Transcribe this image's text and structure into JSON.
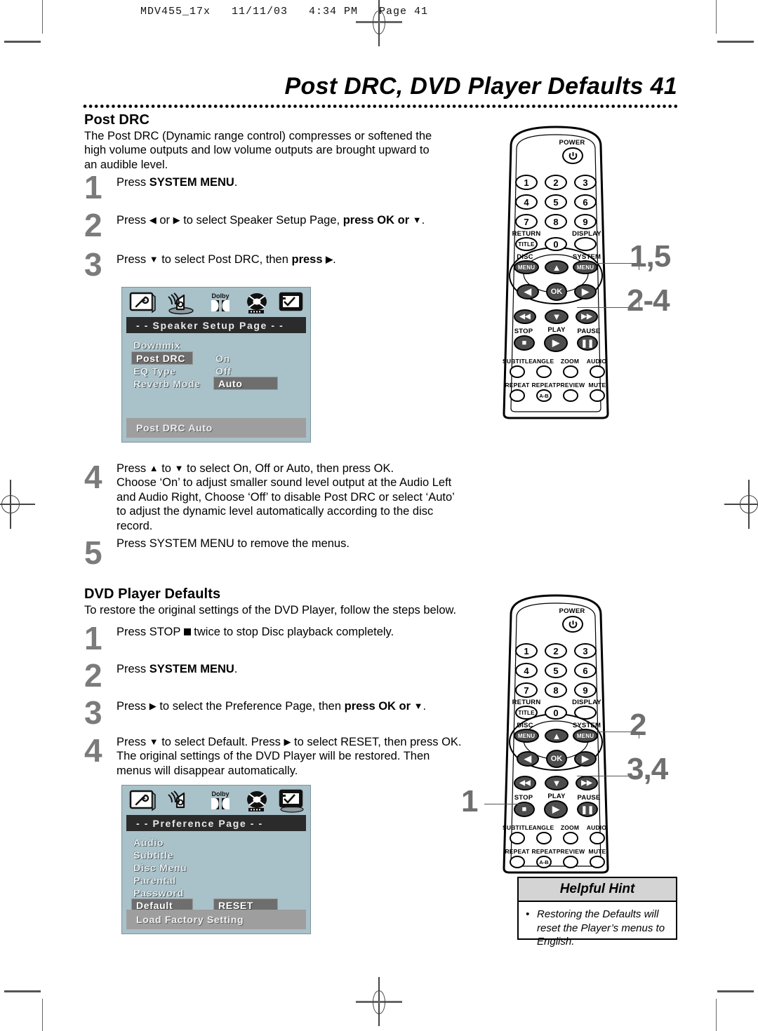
{
  "printer_header": "MDV455_17x   11/11/03   4:34 PM   Page 41",
  "page_title": "Post DRC, DVD Player Defaults  41",
  "page_number": "41",
  "sections": [
    {
      "heading": "Post DRC",
      "intro": "The Post DRC (Dynamic range control) compresses or softened the high volume outputs and low volume outputs are brought upward to an audible level.",
      "steps": [
        {
          "num": "1",
          "text_html": "Press <b>SYSTEM MENU</b>."
        },
        {
          "num": "2",
          "text_html": "Press <span class=\"kbd\">◀</span> or <span class=\"kbd\">▶</span> to select Speaker Setup Page, <b>press OK or <span class=\"kbd\">▼</span></b>."
        },
        {
          "num": "3",
          "text_html": "Press <span class=\"kbd\">▼</span> to select Post DRC, then <b>press <span class=\"kbd\">▶</span></b>."
        },
        {
          "num": "4",
          "text_html": "Press <span class=\"kbd\">▲</span> to <span class=\"kbd\">▼</span> to select On, Off or Auto, then press OK.<br>Choose ‘On’ to adjust smaller sound level output at the Audio Left and Audio Right, Choose ‘Off’ to disable Post DRC or select ‘Auto’ to adjust the dynamic level automatically according to the disc record."
        },
        {
          "num": "5",
          "text_html": "Press SYSTEM MENU to remove the menus."
        }
      ]
    },
    {
      "heading": "DVD Player Defaults",
      "intro": "To restore the original settings of the DVD Player, follow the steps below.",
      "steps": [
        {
          "num": "1",
          "text_html": "Press STOP <span class=\"sq\"></span> twice to stop Disc playback completely."
        },
        {
          "num": "2",
          "text_html": "Press <b>SYSTEM MENU</b>."
        },
        {
          "num": "3",
          "text_html": "Press <span class=\"kbd\">▶</span> to select the Preference Page, then <b>press OK or <span class=\"kbd\">▼</span></b>."
        },
        {
          "num": "4",
          "text_html": "Press <span class=\"kbd\">▼</span> to select Default. Press <span class=\"kbd\">▶</span> to select RESET, then press OK.<br>The original settings of the DVD Player will be restored. Then menus will disappear automatically."
        }
      ]
    }
  ],
  "osd_speaker": {
    "icons": [
      "general-setup-icon",
      "speaker-setup-icon",
      "dolby-audio-icon",
      "video-setup-icon",
      "preference-icon"
    ],
    "title": "- -  Speaker Setup Page  - -",
    "rows": [
      {
        "label": "Downmix",
        "value": "",
        "label_highlighted": false,
        "value_highlighted": false
      },
      {
        "label": "Post DRC",
        "value": "On",
        "label_highlighted": true,
        "value_highlighted": false
      },
      {
        "label": "EQ Type",
        "value": "Off",
        "label_highlighted": false,
        "value_highlighted": false
      },
      {
        "label": "Reverb Mode",
        "value": "Auto",
        "label_highlighted": false,
        "value_highlighted": true
      }
    ],
    "footer": "Post DRC Auto"
  },
  "osd_preference": {
    "icons": [
      "general-setup-icon",
      "speaker-setup-icon",
      "dolby-audio-icon",
      "video-setup-icon",
      "preference-icon"
    ],
    "title": "- -  Preference Page  - -",
    "rows": [
      {
        "label": "Audio",
        "value": "",
        "label_highlighted": false,
        "value_highlighted": false
      },
      {
        "label": "Subtitle",
        "value": "",
        "label_highlighted": false,
        "value_highlighted": false
      },
      {
        "label": "Disc Menu",
        "value": "",
        "label_highlighted": false,
        "value_highlighted": false
      },
      {
        "label": "Parental",
        "value": "",
        "label_highlighted": false,
        "value_highlighted": false
      },
      {
        "label": "Password",
        "value": "",
        "label_highlighted": false,
        "value_highlighted": false
      },
      {
        "label": "Default",
        "value": "RESET",
        "label_highlighted": true,
        "value_highlighted": true
      }
    ],
    "footer": "Load Factory Setting"
  },
  "remote": {
    "power_label": "POWER",
    "keys": [
      "1",
      "2",
      "3",
      "4",
      "5",
      "6",
      "7",
      "8",
      "9",
      "0"
    ],
    "return_label": "RETURN",
    "display_label": "DISPLAY",
    "title_label": "TITLE",
    "disc_label": "DISC",
    "system_label": "SYSTEM",
    "menu_label": "MENU",
    "ok_label": "OK",
    "stop_label": "STOP",
    "play_label": "PLAY",
    "pause_label": "PAUSE",
    "row_labels_1": [
      "SUBTITLE",
      "ANGLE",
      "ZOOM",
      "AUDIO"
    ],
    "row_labels_2": [
      "REPEAT",
      "REPEAT",
      "PREVIEW",
      "MUTE"
    ],
    "ab_label": "A-B"
  },
  "callouts": {
    "remote_top": [
      "1,5",
      "2-4"
    ],
    "remote_bottom_right": [
      "2",
      "3,4"
    ],
    "remote_bottom_left": "1"
  },
  "helpful_hint": {
    "title": "Helpful Hint",
    "bullet": "•",
    "body": "Restoring the Defaults will reset the Player’s menus to English."
  },
  "colors": {
    "step_number": "#7b7b7b",
    "osd_background": "#a9c1c9",
    "osd_titlebar": "#2b2b2b",
    "osd_highlight": "#6e6e6e",
    "osd_footer": "#9e9e9e",
    "hint_header": "#d4d4d4"
  }
}
